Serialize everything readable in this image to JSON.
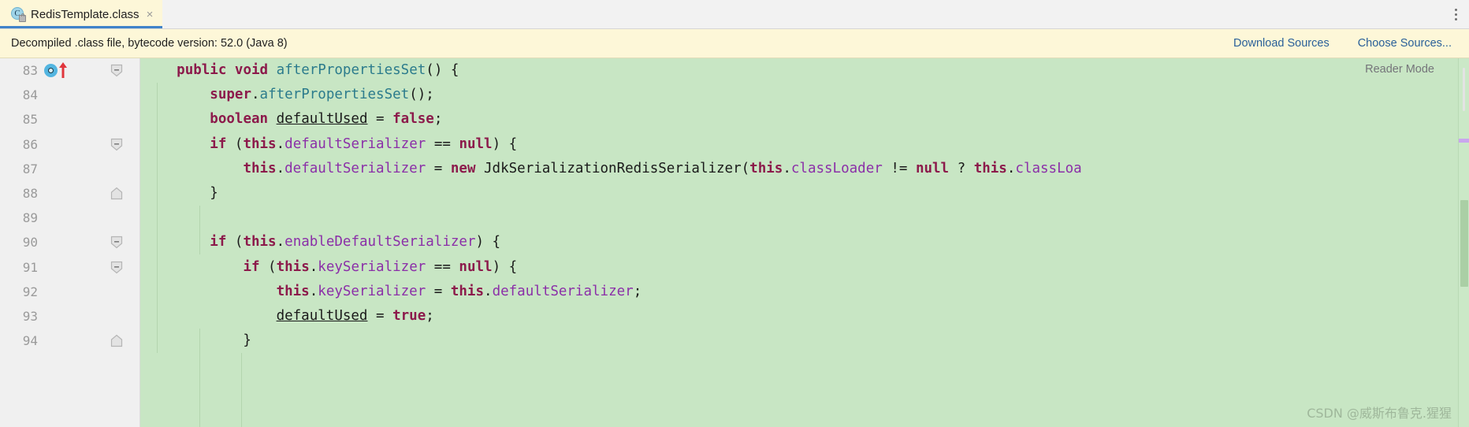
{
  "tab": {
    "icon": "java-class-icon",
    "letter": "C",
    "title": "RedisTemplate.class",
    "close": "×"
  },
  "titlebar": {
    "overflow_menu": "more-options-icon"
  },
  "banner": {
    "message": "Decompiled .class file, bytecode version: 52.0 (Java 8)",
    "download_sources": "Download Sources",
    "choose_sources": "Choose Sources..."
  },
  "editor": {
    "reader_mode": "Reader Mode",
    "background": "#c8e6c4",
    "gutter_background": "#f0f0f0",
    "line_number_color": "#9a9a9a",
    "keyword_color": "#8c1a4b",
    "method_color": "#2b7b8c",
    "field_color": "#8b2fa8",
    "gutter": [
      {
        "number": "83",
        "run_marker": true,
        "override_arrow": true,
        "fold": "minus"
      },
      {
        "number": "84",
        "run_marker": false,
        "override_arrow": false,
        "fold": "none"
      },
      {
        "number": "85",
        "run_marker": false,
        "override_arrow": false,
        "fold": "none"
      },
      {
        "number": "86",
        "run_marker": false,
        "override_arrow": false,
        "fold": "minus"
      },
      {
        "number": "87",
        "run_marker": false,
        "override_arrow": false,
        "fold": "none"
      },
      {
        "number": "88",
        "run_marker": false,
        "override_arrow": false,
        "fold": "end"
      },
      {
        "number": "89",
        "run_marker": false,
        "override_arrow": false,
        "fold": "none"
      },
      {
        "number": "90",
        "run_marker": false,
        "override_arrow": false,
        "fold": "minus"
      },
      {
        "number": "91",
        "run_marker": false,
        "override_arrow": false,
        "fold": "minus"
      },
      {
        "number": "92",
        "run_marker": false,
        "override_arrow": false,
        "fold": "none"
      },
      {
        "number": "93",
        "run_marker": false,
        "override_arrow": false,
        "fold": "none"
      },
      {
        "number": "94",
        "run_marker": false,
        "override_arrow": false,
        "fold": "end"
      }
    ],
    "lines": [
      [
        {
          "t": "    ",
          "c": "pln"
        },
        {
          "t": "public",
          "c": "kw"
        },
        {
          "t": " ",
          "c": "pln"
        },
        {
          "t": "void",
          "c": "kw"
        },
        {
          "t": " ",
          "c": "pln"
        },
        {
          "t": "afterPropertiesSet",
          "c": "fn"
        },
        {
          "t": "() {",
          "c": "pln"
        }
      ],
      [
        {
          "t": "        ",
          "c": "pln"
        },
        {
          "t": "super",
          "c": "kw"
        },
        {
          "t": ".",
          "c": "pln"
        },
        {
          "t": "afterPropertiesSet",
          "c": "fn"
        },
        {
          "t": "();",
          "c": "pln"
        }
      ],
      [
        {
          "t": "        ",
          "c": "pln"
        },
        {
          "t": "boolean",
          "c": "kw"
        },
        {
          "t": " ",
          "c": "pln"
        },
        {
          "t": "defaultUsed",
          "c": "lvar"
        },
        {
          "t": " = ",
          "c": "pln"
        },
        {
          "t": "false",
          "c": "kw"
        },
        {
          "t": ";",
          "c": "pln"
        }
      ],
      [
        {
          "t": "        ",
          "c": "pln"
        },
        {
          "t": "if",
          "c": "kw"
        },
        {
          "t": " (",
          "c": "pln"
        },
        {
          "t": "this",
          "c": "kw"
        },
        {
          "t": ".",
          "c": "pln"
        },
        {
          "t": "defaultSerializer",
          "c": "fld"
        },
        {
          "t": " == ",
          "c": "pln"
        },
        {
          "t": "null",
          "c": "kw"
        },
        {
          "t": ") {",
          "c": "pln"
        }
      ],
      [
        {
          "t": "            ",
          "c": "pln"
        },
        {
          "t": "this",
          "c": "kw"
        },
        {
          "t": ".",
          "c": "pln"
        },
        {
          "t": "defaultSerializer",
          "c": "fld"
        },
        {
          "t": " = ",
          "c": "pln"
        },
        {
          "t": "new",
          "c": "kw"
        },
        {
          "t": " JdkSerializationRedisSerializer(",
          "c": "pln"
        },
        {
          "t": "this",
          "c": "kw"
        },
        {
          "t": ".",
          "c": "pln"
        },
        {
          "t": "classLoader",
          "c": "fld"
        },
        {
          "t": " != ",
          "c": "pln"
        },
        {
          "t": "null",
          "c": "kw"
        },
        {
          "t": " ? ",
          "c": "pln"
        },
        {
          "t": "this",
          "c": "kw"
        },
        {
          "t": ".",
          "c": "pln"
        },
        {
          "t": "classLoa",
          "c": "fld"
        }
      ],
      [
        {
          "t": "        }",
          "c": "pln"
        }
      ],
      [
        {
          "t": "",
          "c": "pln"
        }
      ],
      [
        {
          "t": "        ",
          "c": "pln"
        },
        {
          "t": "if",
          "c": "kw"
        },
        {
          "t": " (",
          "c": "pln"
        },
        {
          "t": "this",
          "c": "kw"
        },
        {
          "t": ".",
          "c": "pln"
        },
        {
          "t": "enableDefaultSerializer",
          "c": "fld"
        },
        {
          "t": ") {",
          "c": "pln"
        }
      ],
      [
        {
          "t": "            ",
          "c": "pln"
        },
        {
          "t": "if",
          "c": "kw"
        },
        {
          "t": " (",
          "c": "pln"
        },
        {
          "t": "this",
          "c": "kw"
        },
        {
          "t": ".",
          "c": "pln"
        },
        {
          "t": "keySerializer",
          "c": "fld"
        },
        {
          "t": " == ",
          "c": "pln"
        },
        {
          "t": "null",
          "c": "kw"
        },
        {
          "t": ") {",
          "c": "pln"
        }
      ],
      [
        {
          "t": "                ",
          "c": "pln"
        },
        {
          "t": "this",
          "c": "kw"
        },
        {
          "t": ".",
          "c": "pln"
        },
        {
          "t": "keySerializer",
          "c": "fld"
        },
        {
          "t": " = ",
          "c": "pln"
        },
        {
          "t": "this",
          "c": "kw"
        },
        {
          "t": ".",
          "c": "pln"
        },
        {
          "t": "defaultSerializer",
          "c": "fld"
        },
        {
          "t": ";",
          "c": "pln"
        }
      ],
      [
        {
          "t": "                ",
          "c": "pln"
        },
        {
          "t": "defaultUsed",
          "c": "lvar"
        },
        {
          "t": " = ",
          "c": "pln"
        },
        {
          "t": "true",
          "c": "kw"
        },
        {
          "t": ";",
          "c": "pln"
        }
      ],
      [
        {
          "t": "            }",
          "c": "pln"
        }
      ]
    ]
  },
  "watermark": "CSDN @威斯布鲁克.猩猩"
}
